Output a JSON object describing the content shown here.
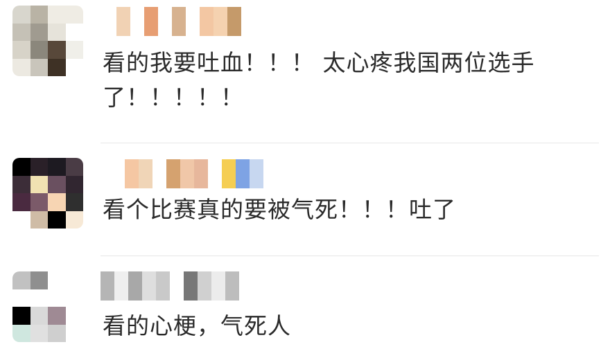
{
  "comments": [
    {
      "text": "看的我要吐血！！！太心疼我国两位选手了！！！！！",
      "line1": "看的我要吐血！！！ 太心疼我国两位选手",
      "line2": "了！！！！！",
      "avatar_colors": [
        "#d8d6cd",
        "#b9b3a5",
        "#efece4",
        "#efece4",
        "#c5c1b6",
        "#a09b90",
        "#e6e3da",
        "#ffffff",
        "#d7d3c8",
        "#8b877c",
        "#58483a",
        "#f0efe9",
        "#ece9e1",
        "#c9c5bb",
        "#3e3125",
        "#ffffff"
      ],
      "name_colors": [
        "#ffffff",
        "#f1d2b4",
        "#ffffff",
        "#e79e73",
        "#ffffff",
        "#d7b28f",
        "#ffffff",
        "#f3c7a3",
        "#f5d2b0",
        "#c59a6a"
      ]
    },
    {
      "text": "看个比赛真的要被气死！！！吐了",
      "avatar_colors": [
        "#000000",
        "#2a2028",
        "#1d1a21",
        "#4a3c45",
        "#3c2d38",
        "#f1e2b2",
        "#6a5060",
        "#312630",
        "#4a2a40",
        "#7b5a69",
        "#f7d5b3",
        "#2f2f2f",
        "#ffffff",
        "#cfbca6",
        "#000000",
        "#f7e9d6"
      ],
      "name_colors": [
        "#f5c7a3",
        "#f0d5b7",
        "#ffffff",
        "#d5a26f",
        "#f0c7a8",
        "#e7b79c",
        "#ffffff",
        "#f5ce53",
        "#7ea3e4",
        "#c7d7f0"
      ]
    },
    {
      "text": "看的心梗，气死人",
      "avatar_colors": [
        "#c1c1c1",
        "#8f8f8f",
        "#ffffff",
        "#ffffff",
        "#ffffff",
        "#ffffff",
        "#ffffff",
        "#ffffff",
        "#000000",
        "#d9d9d9",
        "#9f8a94",
        "#ffffff",
        "#cfe7df",
        "#e0e0e0",
        "#cfcfcf",
        "#ffffff"
      ],
      "name_colors": [
        "#b5b5b5",
        "#efefef",
        "#a8a8a8",
        "#dedede",
        "#c9c9c9",
        "#ffffff",
        "#777777",
        "#d0d0d0",
        "#ececec",
        "#bdbdbd"
      ]
    }
  ]
}
